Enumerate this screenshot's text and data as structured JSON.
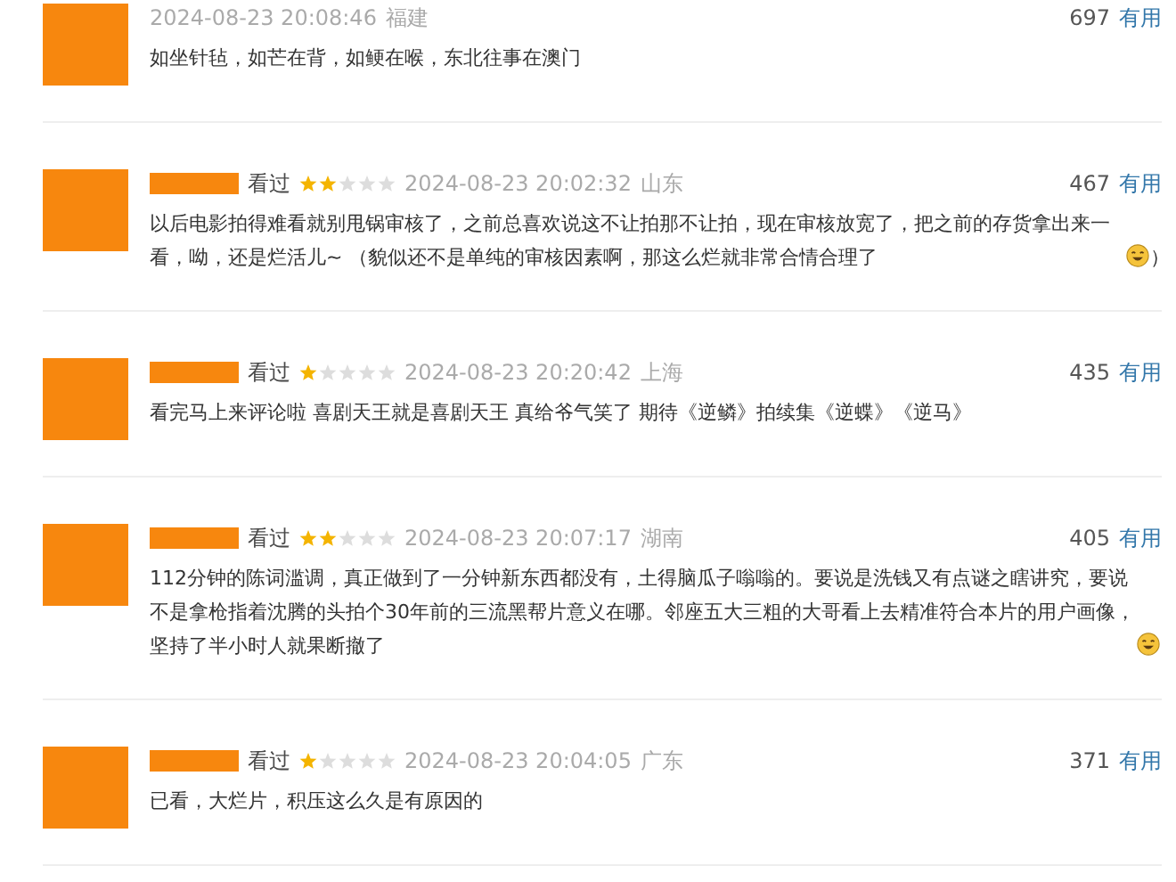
{
  "reviews": [
    {
      "time": "2024-08-23 20:08:46",
      "region": "福建",
      "votes": "697",
      "useful": "有用",
      "parts": [
        {
          "kind": "text",
          "text": "如坐针毡，如芒在背，如鲠在喉，东北往事在澳门"
        }
      ]
    },
    {
      "watched": "看过",
      "stars": 2,
      "time": "2024-08-23 20:02:32",
      "region": "山东",
      "votes": "467",
      "useful": "有用",
      "parts": [
        {
          "kind": "text",
          "text": "以后电影拍得难看就别甩锅审核了，之前总喜欢说这不让拍那不让拍，现在审核放宽了，把之前的存货拿出来一看，呦，还是烂活儿~ （貌似还不是单纯的审核因素啊，那这么烂就非常合情合理了"
        },
        {
          "kind": "emoji"
        },
        {
          "kind": "text",
          "text": "）"
        }
      ]
    },
    {
      "watched": "看过",
      "stars": 1,
      "time": "2024-08-23 20:20:42",
      "region": "上海",
      "votes": "435",
      "useful": "有用",
      "parts": [
        {
          "kind": "text",
          "text": "看完马上来评论啦 喜剧天王就是喜剧天王 真给爷气笑了 期待《逆鳞》拍续集《逆蝶》《逆马》"
        }
      ]
    },
    {
      "watched": "看过",
      "stars": 2,
      "time": "2024-08-23 20:07:17",
      "region": "湖南",
      "votes": "405",
      "useful": "有用",
      "parts": [
        {
          "kind": "text",
          "text": "112分钟的陈词滥调，真正做到了一分钟新东西都没有，土得脑瓜子嗡嗡的。要说是洗钱又有点谜之瞎讲究，要说不是拿枪指着沈腾的头拍个30年前的三流黑帮片意义在哪。邻座五大三粗的大哥看上去精准符合本片的用户画像，坚持了半小时人就果断撤了"
        },
        {
          "kind": "emoji"
        }
      ]
    },
    {
      "watched": "看过",
      "stars": 1,
      "time": "2024-08-23 20:04:05",
      "region": "广东",
      "votes": "371",
      "useful": "有用",
      "parts": [
        {
          "kind": "text",
          "text": "已看，大烂片，积压这么久是有原因的"
        }
      ]
    }
  ]
}
